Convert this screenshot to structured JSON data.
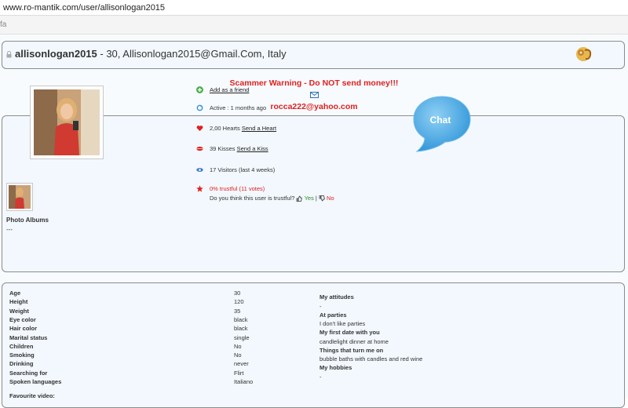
{
  "browser": {
    "url": "www.ro-mantik.com/user/allisonlogan2015",
    "tab_text": "fa"
  },
  "header": {
    "username": "allisonlogan2015",
    "details": " - 30, Allisonlogan2015@Gmail.Com, Italy",
    "zodiac_icon": "leo-zodiac-icon"
  },
  "warning": {
    "text": "Scammer Warning - Do NOT send money!!!",
    "email": "rocca222@yahoo.com",
    "color": "#e02020"
  },
  "profile": {
    "add_friend": "Add as a friend",
    "active": "Active : 1 months ago",
    "hearts": "2,00 Hearts",
    "send_heart": "Send a Heart",
    "kisses": "39 Kisses",
    "send_kiss": "Send a Kiss",
    "visitors": "17 Visitors (last 4 weeks)",
    "trust": "0% trustful (11 votes)",
    "trust_question": "Do you think this user is trustful?",
    "yes": "Yes",
    "no": "No",
    "chat": "Chat",
    "albums_label": "Photo Albums",
    "albums_value": "---"
  },
  "details": [
    {
      "label": "Age",
      "value": "30"
    },
    {
      "label": "Height",
      "value": "120"
    },
    {
      "label": "Weight",
      "value": "35"
    },
    {
      "label": "Eye color",
      "value": "black"
    },
    {
      "label": "Hair color",
      "value": "black"
    },
    {
      "label": "Marital status",
      "value": "single"
    },
    {
      "label": "Children",
      "value": "No"
    },
    {
      "label": "Smoking",
      "value": "No"
    },
    {
      "label": "Drinking",
      "value": "never"
    },
    {
      "label": "Searching for",
      "value": "Flirt"
    },
    {
      "label": "Spoken languages",
      "value": "Italiano"
    }
  ],
  "favourite_video_label": "Favourite video:",
  "attitudes": {
    "title": "My attitudes",
    "title_value": "-",
    "parties_label": "At parties",
    "parties_value": "I don't like parties",
    "first_date_label": "My first date with you",
    "first_date_value": "candlelight dinner at home",
    "turn_on_label": "Things that turn me on",
    "turn_on_value": "bubble baths with candles and red wine",
    "hobbies_label": "My hobbies",
    "hobbies_value": "-"
  },
  "colors": {
    "accent_red": "#e02020",
    "panel_bg": "#f2f8fd",
    "chat_blue": "#4aa8e0"
  }
}
